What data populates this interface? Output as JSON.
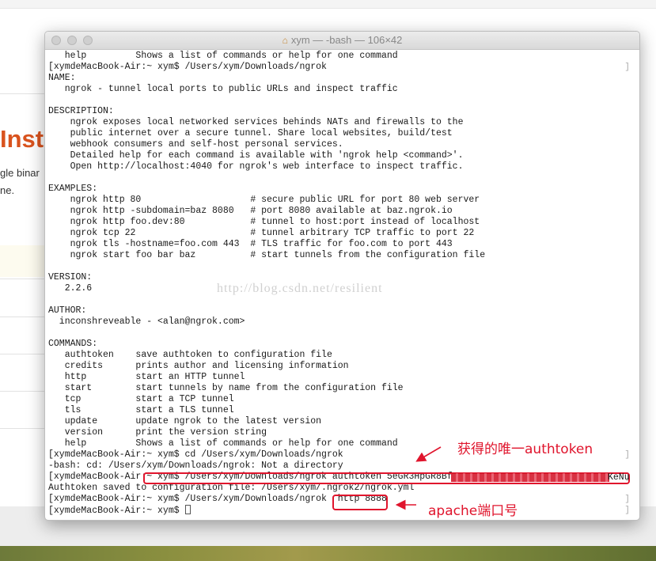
{
  "background": {
    "heading": "Inst",
    "text_line1": "gle binar",
    "text_line2": "ne."
  },
  "window": {
    "title": "xym — -bash — 106×42",
    "title_icon": "home-icon"
  },
  "terminal": {
    "lines": [
      "   help         Shows a list of commands or help for one command",
      "[xymdeMacBook-Air:~ xym$ /Users/xym/Downloads/ngrok",
      "NAME:",
      "   ngrok - tunnel local ports to public URLs and inspect traffic",
      "",
      "DESCRIPTION:",
      "    ngrok exposes local networked services behinds NATs and firewalls to the",
      "    public internet over a secure tunnel. Share local websites, build/test",
      "    webhook consumers and self-host personal services.",
      "    Detailed help for each command is available with 'ngrok help <command>'.",
      "    Open http://localhost:4040 for ngrok's web interface to inspect traffic.",
      "",
      "EXAMPLES:",
      "    ngrok http 80                    # secure public URL for port 80 web server",
      "    ngrok http -subdomain=baz 8080   # port 8080 available at baz.ngrok.io",
      "    ngrok http foo.dev:80            # tunnel to host:port instead of localhost",
      "    ngrok tcp 22                     # tunnel arbitrary TCP traffic to port 22",
      "    ngrok tls -hostname=foo.com 443  # TLS traffic for foo.com to port 443",
      "    ngrok start foo bar baz          # start tunnels from the configuration file",
      "",
      "VERSION:",
      "   2.2.6",
      "",
      "AUTHOR:",
      "  inconshreveable - <alan@ngrok.com>",
      "",
      "COMMANDS:",
      "   authtoken    save authtoken to configuration file",
      "   credits      prints author and licensing information",
      "   http         start an HTTP tunnel",
      "   start        start tunnels by name from the configuration file",
      "   tcp          start a TCP tunnel",
      "   tls          start a TLS tunnel",
      "   update       update ngrok to the latest version",
      "   version      print the version string",
      "   help         Shows a list of commands or help for one command",
      "[xymdeMacBook-Air:~ xym$ cd /Users/xym/Downloads/ngrok",
      "-bash: cd: /Users/xym/Downloads/ngrok: Not a directory",
      "[xymdeMacBook-Air:~ xym$ /Users/xym/Downloads/ngrok authtoken 5eGR3HpGR8Bf",
      "Authtoken saved to configuration file: /Users/xym/.ngrok2/ngrok.yml",
      "[xymdeMacBook-Air:~ xym$ /Users/xym/Downloads/ngrok  http 8888",
      "[xymdeMacBook-Air:~ xym$ "
    ],
    "token_tail": "KeNu",
    "right_bracket": "]"
  },
  "watermark": "http://blog.csdn.net/resilient",
  "annotations": {
    "token_note": "获得的唯一authtoken",
    "port_note": "apache端口号",
    "color": "#e0152d"
  }
}
